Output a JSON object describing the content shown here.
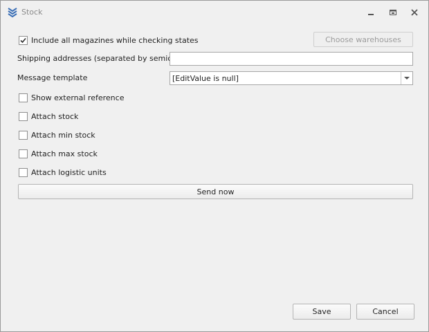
{
  "window": {
    "title": "Stock",
    "icons": {
      "app": "stacked-chevrons-icon",
      "minimize": "minimize-icon",
      "restore": "restore-icon",
      "close": "close-icon"
    }
  },
  "form": {
    "include_all_magazines": {
      "label": "Include all magazines while checking states",
      "checked": true
    },
    "choose_warehouses_label": "Choose warehouses",
    "shipping_addresses": {
      "label": "Shipping addresses (separated by semicolon)",
      "value": ""
    },
    "message_template": {
      "label": "Message template",
      "value": "[EditValue is null]"
    },
    "options": [
      {
        "label": "Show external reference",
        "checked": false
      },
      {
        "label": "Attach stock",
        "checked": false
      },
      {
        "label": "Attach min stock",
        "checked": false
      },
      {
        "label": "Attach max stock",
        "checked": false
      },
      {
        "label": "Attach logistic units",
        "checked": false
      }
    ],
    "send_now_label": "Send now"
  },
  "footer": {
    "save_label": "Save",
    "cancel_label": "Cancel"
  },
  "colors": {
    "icon_blue": "#3b6fb6",
    "title_gray": "#8a8a8a",
    "background": "#f0f0f0"
  }
}
